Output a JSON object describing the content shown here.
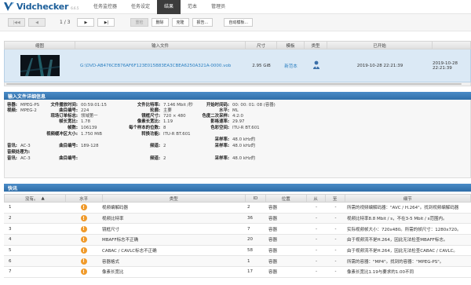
{
  "app": {
    "name": "Vidchecker",
    "version": "6.6.5"
  },
  "nav": [
    "任务监控器",
    "任务设定",
    "结果",
    "范本",
    "管理员"
  ],
  "toolbar": {
    "first": "|◀◀",
    "prev": "◀",
    "page": "1 / 3",
    "next": "▶",
    "last": "▶|",
    "recheck": "重检",
    "delete": "删除",
    "clone": "克隆",
    "report": "报告...",
    "auto_template": "自动模板..."
  },
  "files": {
    "headers": [
      "缩图",
      "输入文件",
      "尺寸",
      "模板",
      "类型",
      "已开始"
    ],
    "row": {
      "file": "G:\\DVD-AB476CEB76AF6F123E015B83EA3CBEA6250A321A-0000.vob",
      "size": "2.95 GiB",
      "template": "新范本",
      "started_1": "2019-10-28 22:21:39",
      "started_2": "2019-10-28 22:21:39"
    }
  },
  "details_title": "输入文件详细信息",
  "details": {
    "container_k": "容器:",
    "container_v": "MPEG-PS",
    "video_k": "视频:",
    "video_v": "MPEG-2",
    "duration_k": "文件播放时间:",
    "duration_v": "00:59:01:15",
    "track_k": "曲目编号:",
    "track_v": "224",
    "field_k": "现场订单标志:",
    "field_v": "领域第一",
    "aspect_k": "帧长宽比:",
    "aspect_v": "1.78",
    "frames_k": "帧数:",
    "frames_v": "106139",
    "vbuf_k": "视频缓冲区大小:",
    "vbuf_v": "1.750 MiB",
    "bitrate_k": "文件比特率:",
    "bitrate_v": "7.146 Mbit /秒",
    "profile_k": "轮廓:",
    "profile_v": "主要",
    "size_k": "镜框尺寸:",
    "size_v": "720 × 480",
    "par_k": "像素长宽比:",
    "par_v": "1.19",
    "hd_k": "每个样本的位数:",
    "hd_v": "8",
    "matrix_k": "转换功能:",
    "matrix_v": "ITU-R BT.601",
    "tc_k": "开始时间码:",
    "tc_v": "00:  00:  01:  08 (容器)",
    "level_k": "水平:",
    "level_v": "ML",
    "chroma_k": "色度二次采样:",
    "chroma_v": "4:2:0",
    "fps_k": "影格速率:",
    "fps_v": "29.97",
    "prim_k": "色彩空间:",
    "prim_v": "ITU-R BT.601",
    "audio1_k": "音讯:",
    "audio1_v": "AC-3",
    "audio1_track_k": "曲目编号:",
    "audio1_track_v": "189-128",
    "audio1_ch_k": "频道:",
    "audio1_ch_v": "2",
    "audio1_sr_k": "采样率:",
    "audio1_sr_v": "48.0 kHz的",
    "sr_top_k": "采样率:",
    "sr_top_v": "48.0 kHz的",
    "audio_proc_k": "音频处理为:",
    "audio2_k": "音讯:",
    "audio2_v": "AC-3",
    "audio2_track_k": "曲目编号:",
    "audio2_ch_k": "频道:",
    "audio2_ch_v": "2",
    "audio2_sr_k": "采样率:",
    "audio2_sr_v": "48.0 kHz的"
  },
  "quick_title": "快讯",
  "errors": {
    "headers": [
      "没有。",
      "水平",
      "类型",
      "ID",
      "位置",
      "从",
      "至",
      "细节"
    ],
    "rows": [
      {
        "no": "1",
        "type": "视频编解码器",
        "id": "2",
        "pos": "容器",
        "from": "-",
        "to": "-",
        "detail": "所需的视频编解码器：\"AVC / H.264\"。找到视频编解码器"
      },
      {
        "no": "2",
        "type": "视频比特率",
        "id": "36",
        "pos": "容器",
        "from": "-",
        "to": "-",
        "detail": "视频比特率8.8 Mbit / s，不在3-5 Mbit / s范围内。"
      },
      {
        "no": "3",
        "type": "镜框尺寸",
        "id": "7",
        "pos": "容器",
        "from": "-",
        "to": "-",
        "detail": "实际视频帧大小：720x480。所需的帧尺寸：1280x720。"
      },
      {
        "no": "4",
        "type": "MBAFF标志不正确",
        "id": "20",
        "pos": "容器",
        "from": "-",
        "to": "-",
        "detail": "由于视频流不是H.264，因此无法检查MBAFF标志。"
      },
      {
        "no": "5",
        "type": "CABAC / CAVLC标志不正确",
        "id": "58",
        "pos": "容器",
        "from": "-",
        "to": "-",
        "detail": "由于视频流不是H.264，因此无法检查CABAC / CAVLC。"
      },
      {
        "no": "6",
        "type": "容器格式",
        "id": "1",
        "pos": "容器",
        "from": "-",
        "to": "-",
        "detail": "所需的容器：\"MP4\"。找到的容器：\"MPEG-PS\"。"
      },
      {
        "no": "7",
        "type": "像素长宽比",
        "id": "17",
        "pos": "容器",
        "from": "-",
        "to": "-",
        "detail": "像素长宽比1.19与要求的1.00不同"
      }
    ]
  },
  "colors": {
    "accent": "#2f6ea8",
    "warn": "#f09a2a",
    "selected_row": "#dbe9f5"
  },
  "icons": {
    "warning": "warning-icon",
    "person": "person-icon"
  }
}
